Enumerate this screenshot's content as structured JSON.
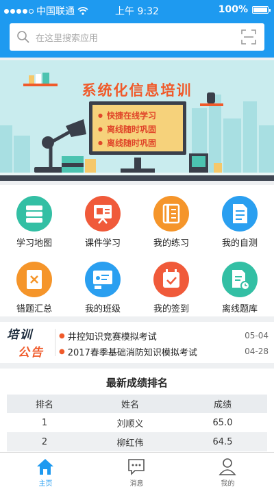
{
  "status": {
    "carrier": "中国联通",
    "time": "上午 9:32",
    "battery": "100%"
  },
  "search": {
    "placeholder": "在这里搜索应用"
  },
  "banner": {
    "title": "系统化信息培训",
    "points": [
      "快捷在线学习",
      "离线随时巩固",
      "离线随时巩固"
    ]
  },
  "features": [
    {
      "label": "学习地图",
      "color": "#33bfa4",
      "icon": "map-icon"
    },
    {
      "label": "课件学习",
      "color": "#f05a3a",
      "icon": "courseware-icon"
    },
    {
      "label": "我的练习",
      "color": "#f5952a",
      "icon": "practice-icon"
    },
    {
      "label": "我的自测",
      "color": "#2a9ff0",
      "icon": "selftest-icon"
    },
    {
      "label": "错题汇总",
      "color": "#f5952a",
      "icon": "wrong-questions-icon"
    },
    {
      "label": "我的班级",
      "color": "#2a9ff0",
      "icon": "class-icon"
    },
    {
      "label": "我的签到",
      "color": "#f05a3a",
      "icon": "signin-icon"
    },
    {
      "label": "离线题库",
      "color": "#33bfa4",
      "icon": "offline-bank-icon"
    }
  ],
  "notice": {
    "tag_line1": "培训",
    "tag_line2": "公告",
    "items": [
      {
        "title": "井控知识竞赛模拟考试",
        "date": "05-04"
      },
      {
        "title": "2017春季基础消防知识模拟考试",
        "date": "04-28"
      }
    ]
  },
  "ranking": {
    "title": "最新成绩排名",
    "headers": [
      "排名",
      "姓名",
      "成绩"
    ],
    "rows": [
      [
        "1",
        "刘顺义",
        "65.0"
      ],
      [
        "2",
        "柳红伟",
        "64.5"
      ]
    ]
  },
  "tabs": [
    {
      "label": "主页",
      "icon": "home-icon",
      "active": true
    },
    {
      "label": "消息",
      "icon": "message-icon",
      "active": false
    },
    {
      "label": "我的",
      "icon": "profile-icon",
      "active": false
    }
  ],
  "colors": {
    "primary": "#1e9af0",
    "accent": "#f05a2a"
  }
}
